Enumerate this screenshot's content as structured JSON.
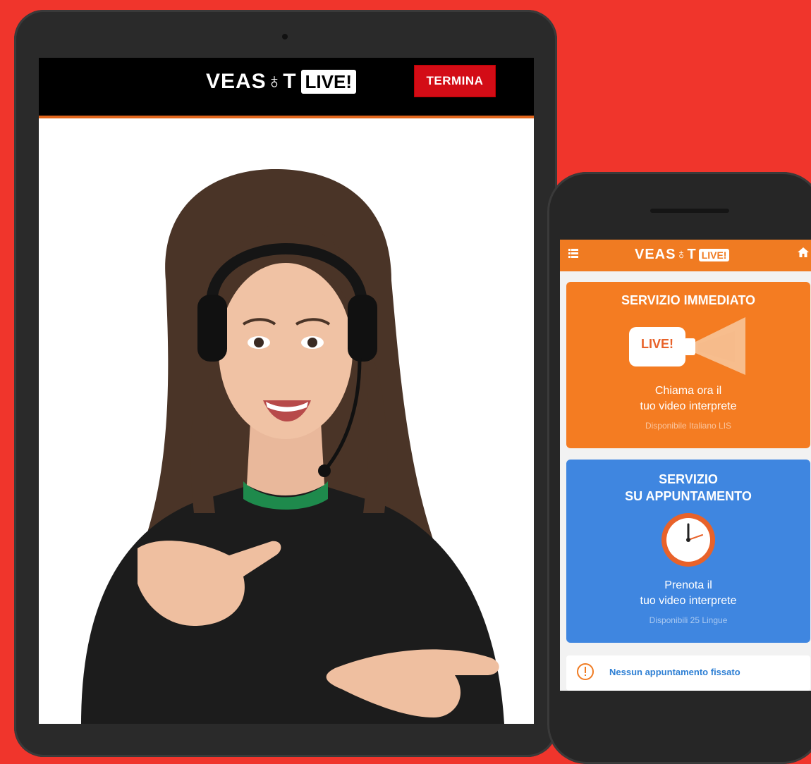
{
  "tablet": {
    "brand": "VEAS♁T",
    "brand_badge": "LIVE!",
    "end_button": "TERMINA",
    "header_line_color": "#e2661c",
    "end_button_color": "#d30c16"
  },
  "phone": {
    "brand": "VEAS♁T",
    "brand_badge": "LIVE!",
    "header_color": "#f07b22",
    "immediate": {
      "title": "SERVIZIO IMMEDIATO",
      "icon_label": "LIVE!",
      "text_line1": "Chiama ora il",
      "text_line2": "tuo video interprete",
      "subtext": "Disponibile Italiano LIS",
      "color": "#f47c22"
    },
    "appointment": {
      "title_line1": "SERVIZIO",
      "title_line2": "SU APPUNTAMENTO",
      "text_line1": "Prenota il",
      "text_line2": "tuo video interprete",
      "subtext": "Disponibili 25 Lingue",
      "color": "#3f86e0"
    },
    "notice": {
      "text": "Nessun appuntamento fissato"
    }
  },
  "icons": [
    "menu-icon",
    "home-icon",
    "video-camera-icon",
    "clock-icon",
    "alert-icon"
  ]
}
